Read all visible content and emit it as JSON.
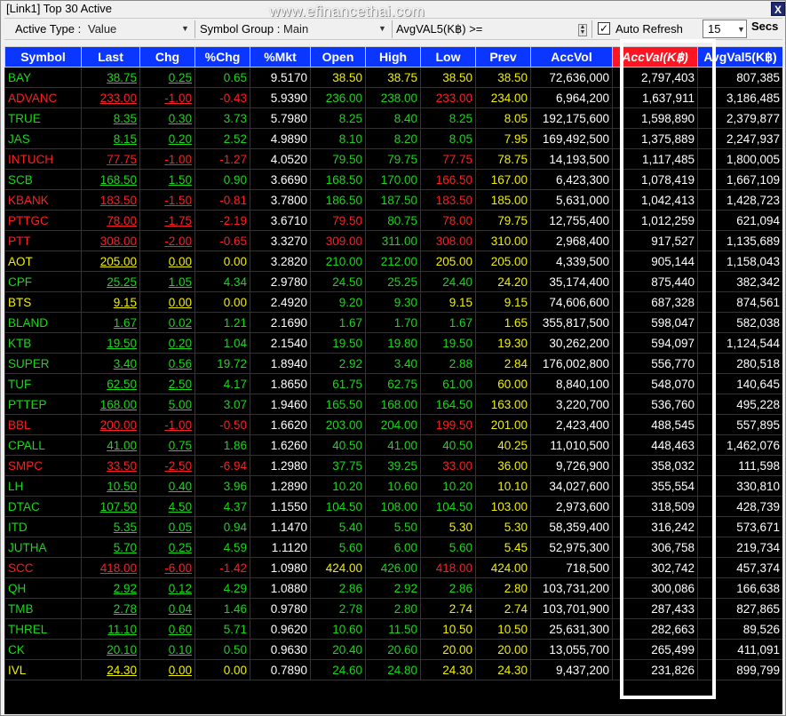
{
  "window": {
    "title": "[Link1] Top 30 Active",
    "watermark": "www.efinancethai.com",
    "close_glyph": "X"
  },
  "toolbar": {
    "active_type_label": "Active Type :",
    "active_type_value": "Value",
    "symbol_group_label": "Symbol Group :",
    "symbol_group_value": "Main",
    "filter_label": "AvgVAL5(K฿) >=",
    "auto_refresh_label": "Auto Refresh",
    "auto_refresh_checked": "✓",
    "interval_value": "15",
    "secs_label": "Secs"
  },
  "columns": [
    "Symbol",
    "Last",
    "Chg",
    "%Chg",
    "%Mkt",
    "Open",
    "High",
    "Low",
    "Prev",
    "AccVol",
    "AccVal(K฿)",
    "AvgVal5(K฿)"
  ],
  "colors": {
    "up": "#18d818",
    "down": "#ff1e1e",
    "unchanged": "#f0f000",
    "header_bg": "#0a36ff",
    "sorted_header_bg": "#ff1522"
  },
  "rows": [
    {
      "c": "g",
      "oc": "y",
      "hc": "y",
      "lc": "y",
      "pc": "y",
      "v": [
        "BAY",
        "38.75",
        "0.25",
        "0.65",
        "9.5170",
        "38.50",
        "38.75",
        "38.50",
        "38.50",
        "72,636,000",
        "2,797,403",
        "807,385"
      ]
    },
    {
      "c": "r",
      "oc": "g",
      "hc": "g",
      "lc": "r",
      "pc": "y",
      "v": [
        "ADVANC",
        "233.00",
        "-1.00",
        "-0.43",
        "5.9390",
        "236.00",
        "238.00",
        "233.00",
        "234.00",
        "6,964,200",
        "1,637,911",
        "3,186,485"
      ]
    },
    {
      "c": "g",
      "oc": "g",
      "hc": "g",
      "lc": "g",
      "pc": "y",
      "v": [
        "TRUE",
        "8.35",
        "0.30",
        "3.73",
        "5.7980",
        "8.25",
        "8.40",
        "8.25",
        "8.05",
        "192,175,600",
        "1,598,890",
        "2,379,877"
      ]
    },
    {
      "c": "g",
      "oc": "g",
      "hc": "g",
      "lc": "g",
      "pc": "y",
      "v": [
        "JAS",
        "8.15",
        "0.20",
        "2.52",
        "4.9890",
        "8.10",
        "8.20",
        "8.05",
        "7.95",
        "169,492,500",
        "1,375,889",
        "2,247,937"
      ]
    },
    {
      "c": "r",
      "oc": "g",
      "hc": "g",
      "lc": "r",
      "pc": "y",
      "v": [
        "INTUCH",
        "77.75",
        "-1.00",
        "-1.27",
        "4.0520",
        "79.50",
        "79.75",
        "77.75",
        "78.75",
        "14,193,500",
        "1,117,485",
        "1,800,005"
      ]
    },
    {
      "c": "g",
      "oc": "g",
      "hc": "g",
      "lc": "r",
      "pc": "y",
      "v": [
        "SCB",
        "168.50",
        "1.50",
        "0.90",
        "3.6690",
        "168.50",
        "170.00",
        "166.50",
        "167.00",
        "6,423,300",
        "1,078,419",
        "1,667,109"
      ]
    },
    {
      "c": "r",
      "oc": "g",
      "hc": "g",
      "lc": "r",
      "pc": "y",
      "v": [
        "KBANK",
        "183.50",
        "-1.50",
        "-0.81",
        "3.7800",
        "186.50",
        "187.50",
        "183.50",
        "185.00",
        "5,631,000",
        "1,042,413",
        "1,428,723"
      ]
    },
    {
      "c": "r",
      "oc": "r",
      "hc": "g",
      "lc": "r",
      "pc": "y",
      "v": [
        "PTTGC",
        "78.00",
        "-1.75",
        "-2.19",
        "3.6710",
        "79.50",
        "80.75",
        "78.00",
        "79.75",
        "12,755,400",
        "1,012,259",
        "621,094"
      ]
    },
    {
      "c": "r",
      "oc": "r",
      "hc": "g",
      "lc": "r",
      "pc": "y",
      "v": [
        "PTT",
        "308.00",
        "-2.00",
        "-0.65",
        "3.3270",
        "309.00",
        "311.00",
        "308.00",
        "310.00",
        "2,968,400",
        "917,527",
        "1,135,689"
      ]
    },
    {
      "c": "y",
      "oc": "g",
      "hc": "g",
      "lc": "y",
      "pc": "y",
      "v": [
        "AOT",
        "205.00",
        "0.00",
        "0.00",
        "3.2820",
        "210.00",
        "212.00",
        "205.00",
        "205.00",
        "4,339,500",
        "905,144",
        "1,158,043"
      ]
    },
    {
      "c": "g",
      "oc": "g",
      "hc": "g",
      "lc": "g",
      "pc": "y",
      "v": [
        "CPF",
        "25.25",
        "1.05",
        "4.34",
        "2.9780",
        "24.50",
        "25.25",
        "24.40",
        "24.20",
        "35,174,400",
        "875,440",
        "382,342"
      ]
    },
    {
      "c": "y",
      "oc": "g",
      "hc": "g",
      "lc": "y",
      "pc": "y",
      "v": [
        "BTS",
        "9.15",
        "0.00",
        "0.00",
        "2.4920",
        "9.20",
        "9.30",
        "9.15",
        "9.15",
        "74,606,600",
        "687,328",
        "874,561"
      ]
    },
    {
      "c": "g",
      "oc": "g",
      "hc": "g",
      "lc": "g",
      "pc": "y",
      "v": [
        "BLAND",
        "1.67",
        "0.02",
        "1.21",
        "2.1690",
        "1.67",
        "1.70",
        "1.67",
        "1.65",
        "355,817,500",
        "598,047",
        "582,038"
      ]
    },
    {
      "c": "g",
      "oc": "g",
      "hc": "g",
      "lc": "g",
      "pc": "y",
      "v": [
        "KTB",
        "19.50",
        "0.20",
        "1.04",
        "2.1540",
        "19.50",
        "19.80",
        "19.50",
        "19.30",
        "30,262,200",
        "594,097",
        "1,124,544"
      ]
    },
    {
      "c": "g",
      "oc": "g",
      "hc": "g",
      "lc": "g",
      "pc": "y",
      "v": [
        "SUPER",
        "3.40",
        "0.56",
        "19.72",
        "1.8940",
        "2.92",
        "3.40",
        "2.88",
        "2.84",
        "176,002,800",
        "556,770",
        "280,518"
      ]
    },
    {
      "c": "g",
      "oc": "g",
      "hc": "g",
      "lc": "g",
      "pc": "y",
      "v": [
        "TUF",
        "62.50",
        "2.50",
        "4.17",
        "1.8650",
        "61.75",
        "62.75",
        "61.00",
        "60.00",
        "8,840,100",
        "548,070",
        "140,645"
      ]
    },
    {
      "c": "g",
      "oc": "g",
      "hc": "g",
      "lc": "g",
      "pc": "y",
      "v": [
        "PTTEP",
        "168.00",
        "5.00",
        "3.07",
        "1.9460",
        "165.50",
        "168.00",
        "164.50",
        "163.00",
        "3,220,700",
        "536,760",
        "495,228"
      ]
    },
    {
      "c": "r",
      "oc": "g",
      "hc": "g",
      "lc": "r",
      "pc": "y",
      "v": [
        "BBL",
        "200.00",
        "-1.00",
        "-0.50",
        "1.6620",
        "203.00",
        "204.00",
        "199.50",
        "201.00",
        "2,423,400",
        "488,545",
        "557,895"
      ]
    },
    {
      "c": "g",
      "oc": "g",
      "hc": "g",
      "lc": "g",
      "pc": "y",
      "v": [
        "CPALL",
        "41.00",
        "0.75",
        "1.86",
        "1.6260",
        "40.50",
        "41.00",
        "40.50",
        "40.25",
        "11,010,500",
        "448,463",
        "1,462,076"
      ]
    },
    {
      "c": "r",
      "oc": "g",
      "hc": "g",
      "lc": "r",
      "pc": "y",
      "v": [
        "SMPC",
        "33.50",
        "-2.50",
        "-6.94",
        "1.2980",
        "37.75",
        "39.25",
        "33.00",
        "36.00",
        "9,726,900",
        "358,032",
        "111,598"
      ]
    },
    {
      "c": "g",
      "oc": "g",
      "hc": "g",
      "lc": "g",
      "pc": "y",
      "v": [
        "LH",
        "10.50",
        "0.40",
        "3.96",
        "1.2890",
        "10.20",
        "10.60",
        "10.20",
        "10.10",
        "34,027,600",
        "355,554",
        "330,810"
      ]
    },
    {
      "c": "g",
      "oc": "g",
      "hc": "g",
      "lc": "g",
      "pc": "y",
      "v": [
        "DTAC",
        "107.50",
        "4.50",
        "4.37",
        "1.1550",
        "104.50",
        "108.00",
        "104.50",
        "103.00",
        "2,973,600",
        "318,509",
        "428,739"
      ]
    },
    {
      "c": "g",
      "oc": "g",
      "hc": "g",
      "lc": "y",
      "pc": "y",
      "v": [
        "ITD",
        "5.35",
        "0.05",
        "0.94",
        "1.1470",
        "5.40",
        "5.50",
        "5.30",
        "5.30",
        "58,359,400",
        "316,242",
        "573,671"
      ]
    },
    {
      "c": "g",
      "oc": "g",
      "hc": "g",
      "lc": "g",
      "pc": "y",
      "v": [
        "JUTHA",
        "5.70",
        "0.25",
        "4.59",
        "1.1120",
        "5.60",
        "6.00",
        "5.60",
        "5.45",
        "52,975,300",
        "306,758",
        "219,734"
      ]
    },
    {
      "c": "r",
      "oc": "y",
      "hc": "g",
      "lc": "r",
      "pc": "y",
      "v": [
        "SCC",
        "418.00",
        "-6.00",
        "-1.42",
        "1.0980",
        "424.00",
        "426.00",
        "418.00",
        "424.00",
        "718,500",
        "302,742",
        "457,374"
      ]
    },
    {
      "c": "g",
      "oc": "g",
      "hc": "g",
      "lc": "g",
      "pc": "y",
      "v": [
        "QH",
        "2.92",
        "0.12",
        "4.29",
        "1.0880",
        "2.86",
        "2.92",
        "2.86",
        "2.80",
        "103,731,200",
        "300,086",
        "166,638"
      ]
    },
    {
      "c": "g",
      "oc": "g",
      "hc": "g",
      "lc": "y",
      "pc": "y",
      "v": [
        "TMB",
        "2.78",
        "0.04",
        "1.46",
        "0.9780",
        "2.78",
        "2.80",
        "2.74",
        "2.74",
        "103,701,900",
        "287,433",
        "827,865"
      ]
    },
    {
      "c": "g",
      "oc": "g",
      "hc": "g",
      "lc": "y",
      "pc": "y",
      "v": [
        "THREL",
        "11.10",
        "0.60",
        "5.71",
        "0.9620",
        "10.60",
        "11.50",
        "10.50",
        "10.50",
        "25,631,300",
        "282,663",
        "89,526"
      ]
    },
    {
      "c": "g",
      "oc": "g",
      "hc": "g",
      "lc": "y",
      "pc": "y",
      "v": [
        "CK",
        "20.10",
        "0.10",
        "0.50",
        "0.9630",
        "20.40",
        "20.60",
        "20.00",
        "20.00",
        "13,055,700",
        "265,499",
        "411,091"
      ]
    },
    {
      "c": "y",
      "oc": "g",
      "hc": "g",
      "lc": "y",
      "pc": "y",
      "v": [
        "IVL",
        "24.30",
        "0.00",
        "0.00",
        "0.7890",
        "24.60",
        "24.80",
        "24.30",
        "24.30",
        "9,437,200",
        "231,826",
        "899,799"
      ]
    }
  ]
}
